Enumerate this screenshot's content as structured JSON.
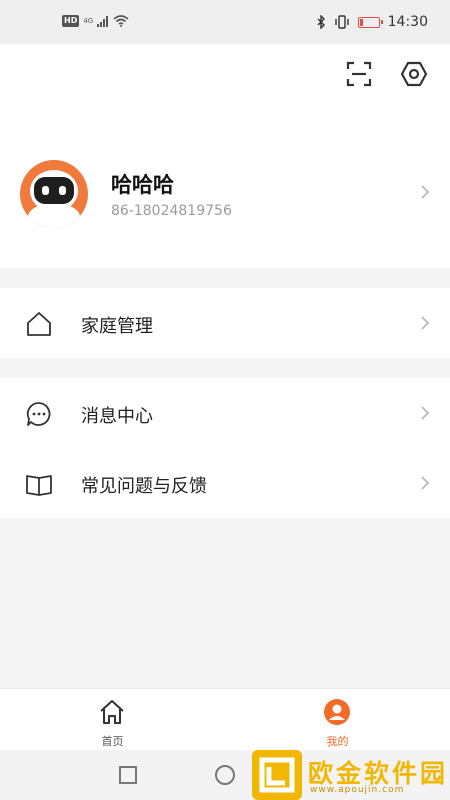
{
  "status_bar": {
    "network_label": "HD",
    "signal_label": "4G",
    "time": "14:30",
    "battery_level": 0.15
  },
  "profile": {
    "name": "哈哈哈",
    "phone": "86-18024819756"
  },
  "menu": {
    "family": "家庭管理",
    "messages": "消息中心",
    "faq": "常见问题与反馈"
  },
  "bottom_nav": {
    "home": "首页",
    "mine": "我的",
    "active_tab": "mine"
  },
  "colors": {
    "accent": "#f26b2a",
    "avatar_bg": "#f07a3c"
  },
  "watermark": {
    "title": "欧金软件园",
    "url": "www.apoujin.com"
  }
}
